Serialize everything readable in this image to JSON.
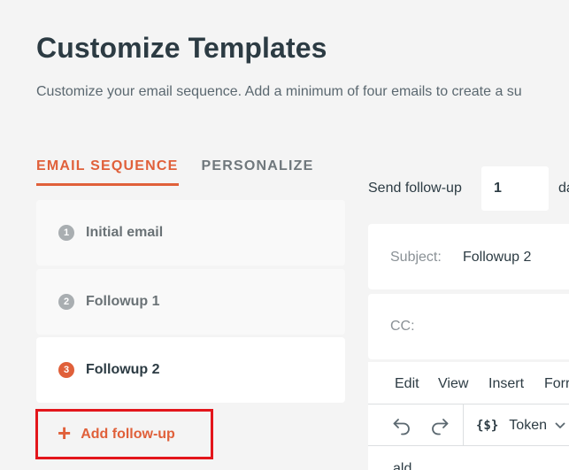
{
  "header": {
    "title": "Customize Templates",
    "subtitle": "Customize your email sequence. Add a minimum of four emails to create a su"
  },
  "tabs": [
    {
      "label": "EMAIL SEQUENCE",
      "active": true
    },
    {
      "label": "PERSONALIZE",
      "active": false
    }
  ],
  "sequence": {
    "items": [
      {
        "number": "1",
        "label": "Initial email",
        "active": false
      },
      {
        "number": "2",
        "label": "Followup 1",
        "active": false
      },
      {
        "number": "3",
        "label": "Followup 2",
        "active": true
      }
    ],
    "add_label": "Add follow-up",
    "add_icon": "plus-icon"
  },
  "send": {
    "label": "Send follow-up",
    "value": "1",
    "suffix": "da"
  },
  "subject": {
    "label": "Subject:",
    "value": "Followup 2"
  },
  "cc": {
    "label": "CC:",
    "value": ""
  },
  "editor": {
    "menu": [
      "Edit",
      "View",
      "Insert",
      "Forr"
    ],
    "toolbar": {
      "undo_icon": "undo-icon",
      "redo_icon": "redo-icon",
      "token_icon_text": "{$}",
      "token_label": "Token",
      "token_chevron": "chevron-down-icon"
    },
    "body_text": "ald"
  },
  "colors": {
    "accent": "#e0603a",
    "highlight_border": "#e3161b",
    "text_dark": "#2c3b43",
    "text_muted": "#6f777c",
    "background": "#f4f4f4"
  }
}
